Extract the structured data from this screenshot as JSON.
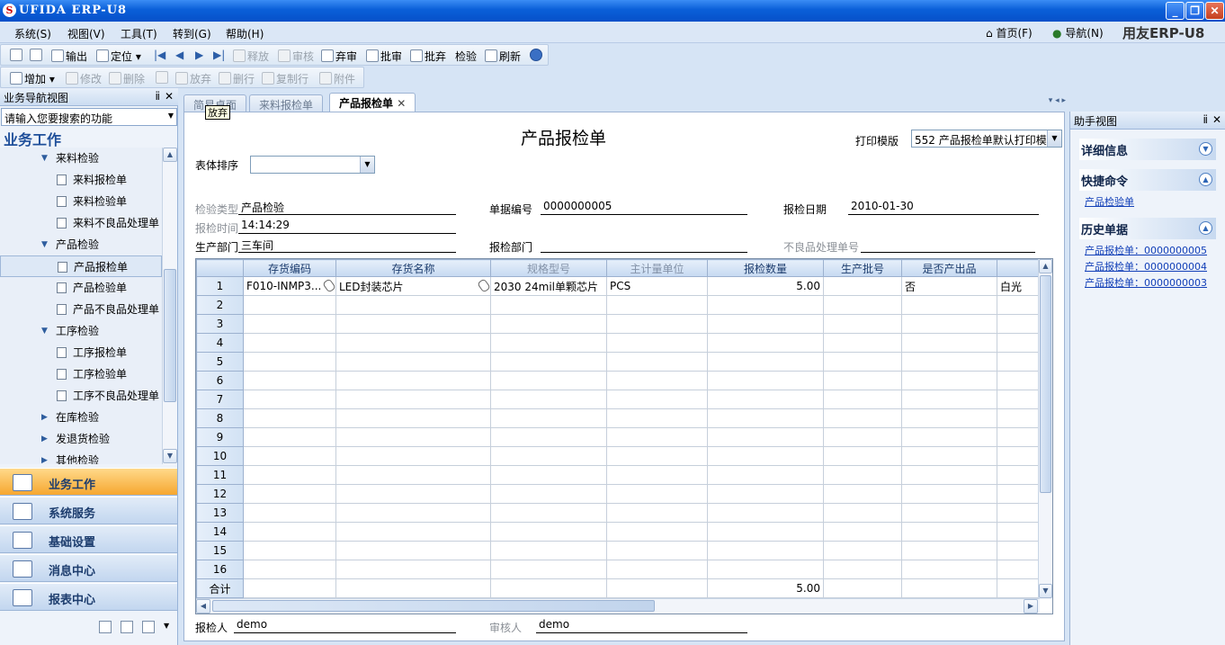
{
  "window": {
    "title": "UFIDA ERP-U8",
    "logo_glyph": "S",
    "min": "_",
    "max": "❐",
    "close": "✕"
  },
  "menu": [
    "系统(S)",
    "视图(V)",
    "工具(T)",
    "转到(G)",
    "帮助(H)"
  ],
  "top_right": {
    "home": "首页(F)",
    "nav": "导航(N)",
    "brand": "用友ERP-U8"
  },
  "toolbar1": {
    "export": "输出",
    "locate": "定位",
    "release": "释放",
    "audit": "审核",
    "abandon_audit": "弃审",
    "batch_audit": "批审",
    "batch_abandon": "批弃",
    "inspect": "检验",
    "refresh": "刷新"
  },
  "toolbar2": {
    "add": "增加",
    "modify": "修改",
    "delete": "删除",
    "abandon": "放弃",
    "delete_row": "删行",
    "copy_row": "复制行",
    "attach": "附件"
  },
  "nav": {
    "header": "业务导航视图",
    "pin": "ⅱ",
    "search_placeholder": "请输入您要搜索的功能",
    "title": "业务工作",
    "tree": [
      {
        "label": "来料检验",
        "level": 1,
        "expanded": true
      },
      {
        "label": "来料报检单",
        "level": 2
      },
      {
        "label": "来料检验单",
        "level": 2
      },
      {
        "label": "来料不良品处理单",
        "level": 2
      },
      {
        "label": "产品检验",
        "level": 1,
        "expanded": true
      },
      {
        "label": "产品报检单",
        "level": 2,
        "selected": true
      },
      {
        "label": "产品检验单",
        "level": 2
      },
      {
        "label": "产品不良品处理单",
        "level": 2
      },
      {
        "label": "工序检验",
        "level": 1,
        "expanded": true
      },
      {
        "label": "工序报检单",
        "level": 2
      },
      {
        "label": "工序检验单",
        "level": 2
      },
      {
        "label": "工序不良品处理单",
        "level": 2
      },
      {
        "label": "在库检验",
        "level": 1,
        "expanded": false
      },
      {
        "label": "发退货检验",
        "level": 1,
        "expanded": false
      },
      {
        "label": "其他检验",
        "level": 1,
        "expanded": false
      }
    ],
    "big_buttons": [
      "业务工作",
      "系统服务",
      "基础设置",
      "消息中心",
      "报表中心"
    ]
  },
  "tabs": [
    "简易桌面",
    "来料报检单",
    "产品报检单"
  ],
  "tooltip": "放弃",
  "form": {
    "title": "产品报检单",
    "print_template_label": "打印模版",
    "print_template_value": "552 产品报检单默认打印模",
    "sort_label": "表体排序",
    "sort_value": "",
    "fields": {
      "inspect_type_label": "检验类型",
      "inspect_type": "产品检验",
      "doc_no_label": "单据编号",
      "doc_no": "0000000005",
      "date_label": "报检日期",
      "date": "2010-01-30",
      "time_label": "报检时间",
      "time": "14:14:29",
      "dept_label": "生产部门",
      "dept": "三车间",
      "inspect_dept_label": "报检部门",
      "inspect_dept": "",
      "defect_no_label": "不良品处理单号",
      "defect_no": ""
    },
    "footer": {
      "reporter_label": "报检人",
      "reporter": "demo",
      "auditor_label": "审核人",
      "auditor": "demo"
    }
  },
  "grid": {
    "columns": [
      "存货编码",
      "存货名称",
      "规格型号",
      "主计量单位",
      "报检数量",
      "生产批号",
      "是否产出品",
      ""
    ],
    "rows": [
      [
        "1",
        "F010-INMP3...",
        "LED封装芯片",
        "2030 24mil单颗芯片",
        "PCS",
        "5.00",
        "",
        "否",
        "白光"
      ]
    ],
    "row_numbers": [
      "2",
      "3",
      "4",
      "5",
      "6",
      "7",
      "8",
      "9",
      "10",
      "11",
      "12",
      "13",
      "14",
      "15",
      "16"
    ],
    "total_label": "合计",
    "total_qty": "5.00"
  },
  "helper": {
    "header": "助手视图",
    "sections": [
      {
        "title": "详细信息",
        "links": []
      },
      {
        "title": "快捷命令",
        "links": [
          "产品检验单"
        ]
      },
      {
        "title": "历史单据",
        "links": [
          "产品报检单：0000000005",
          "产品报检单：0000000004",
          "产品报检单：0000000003"
        ]
      }
    ]
  }
}
